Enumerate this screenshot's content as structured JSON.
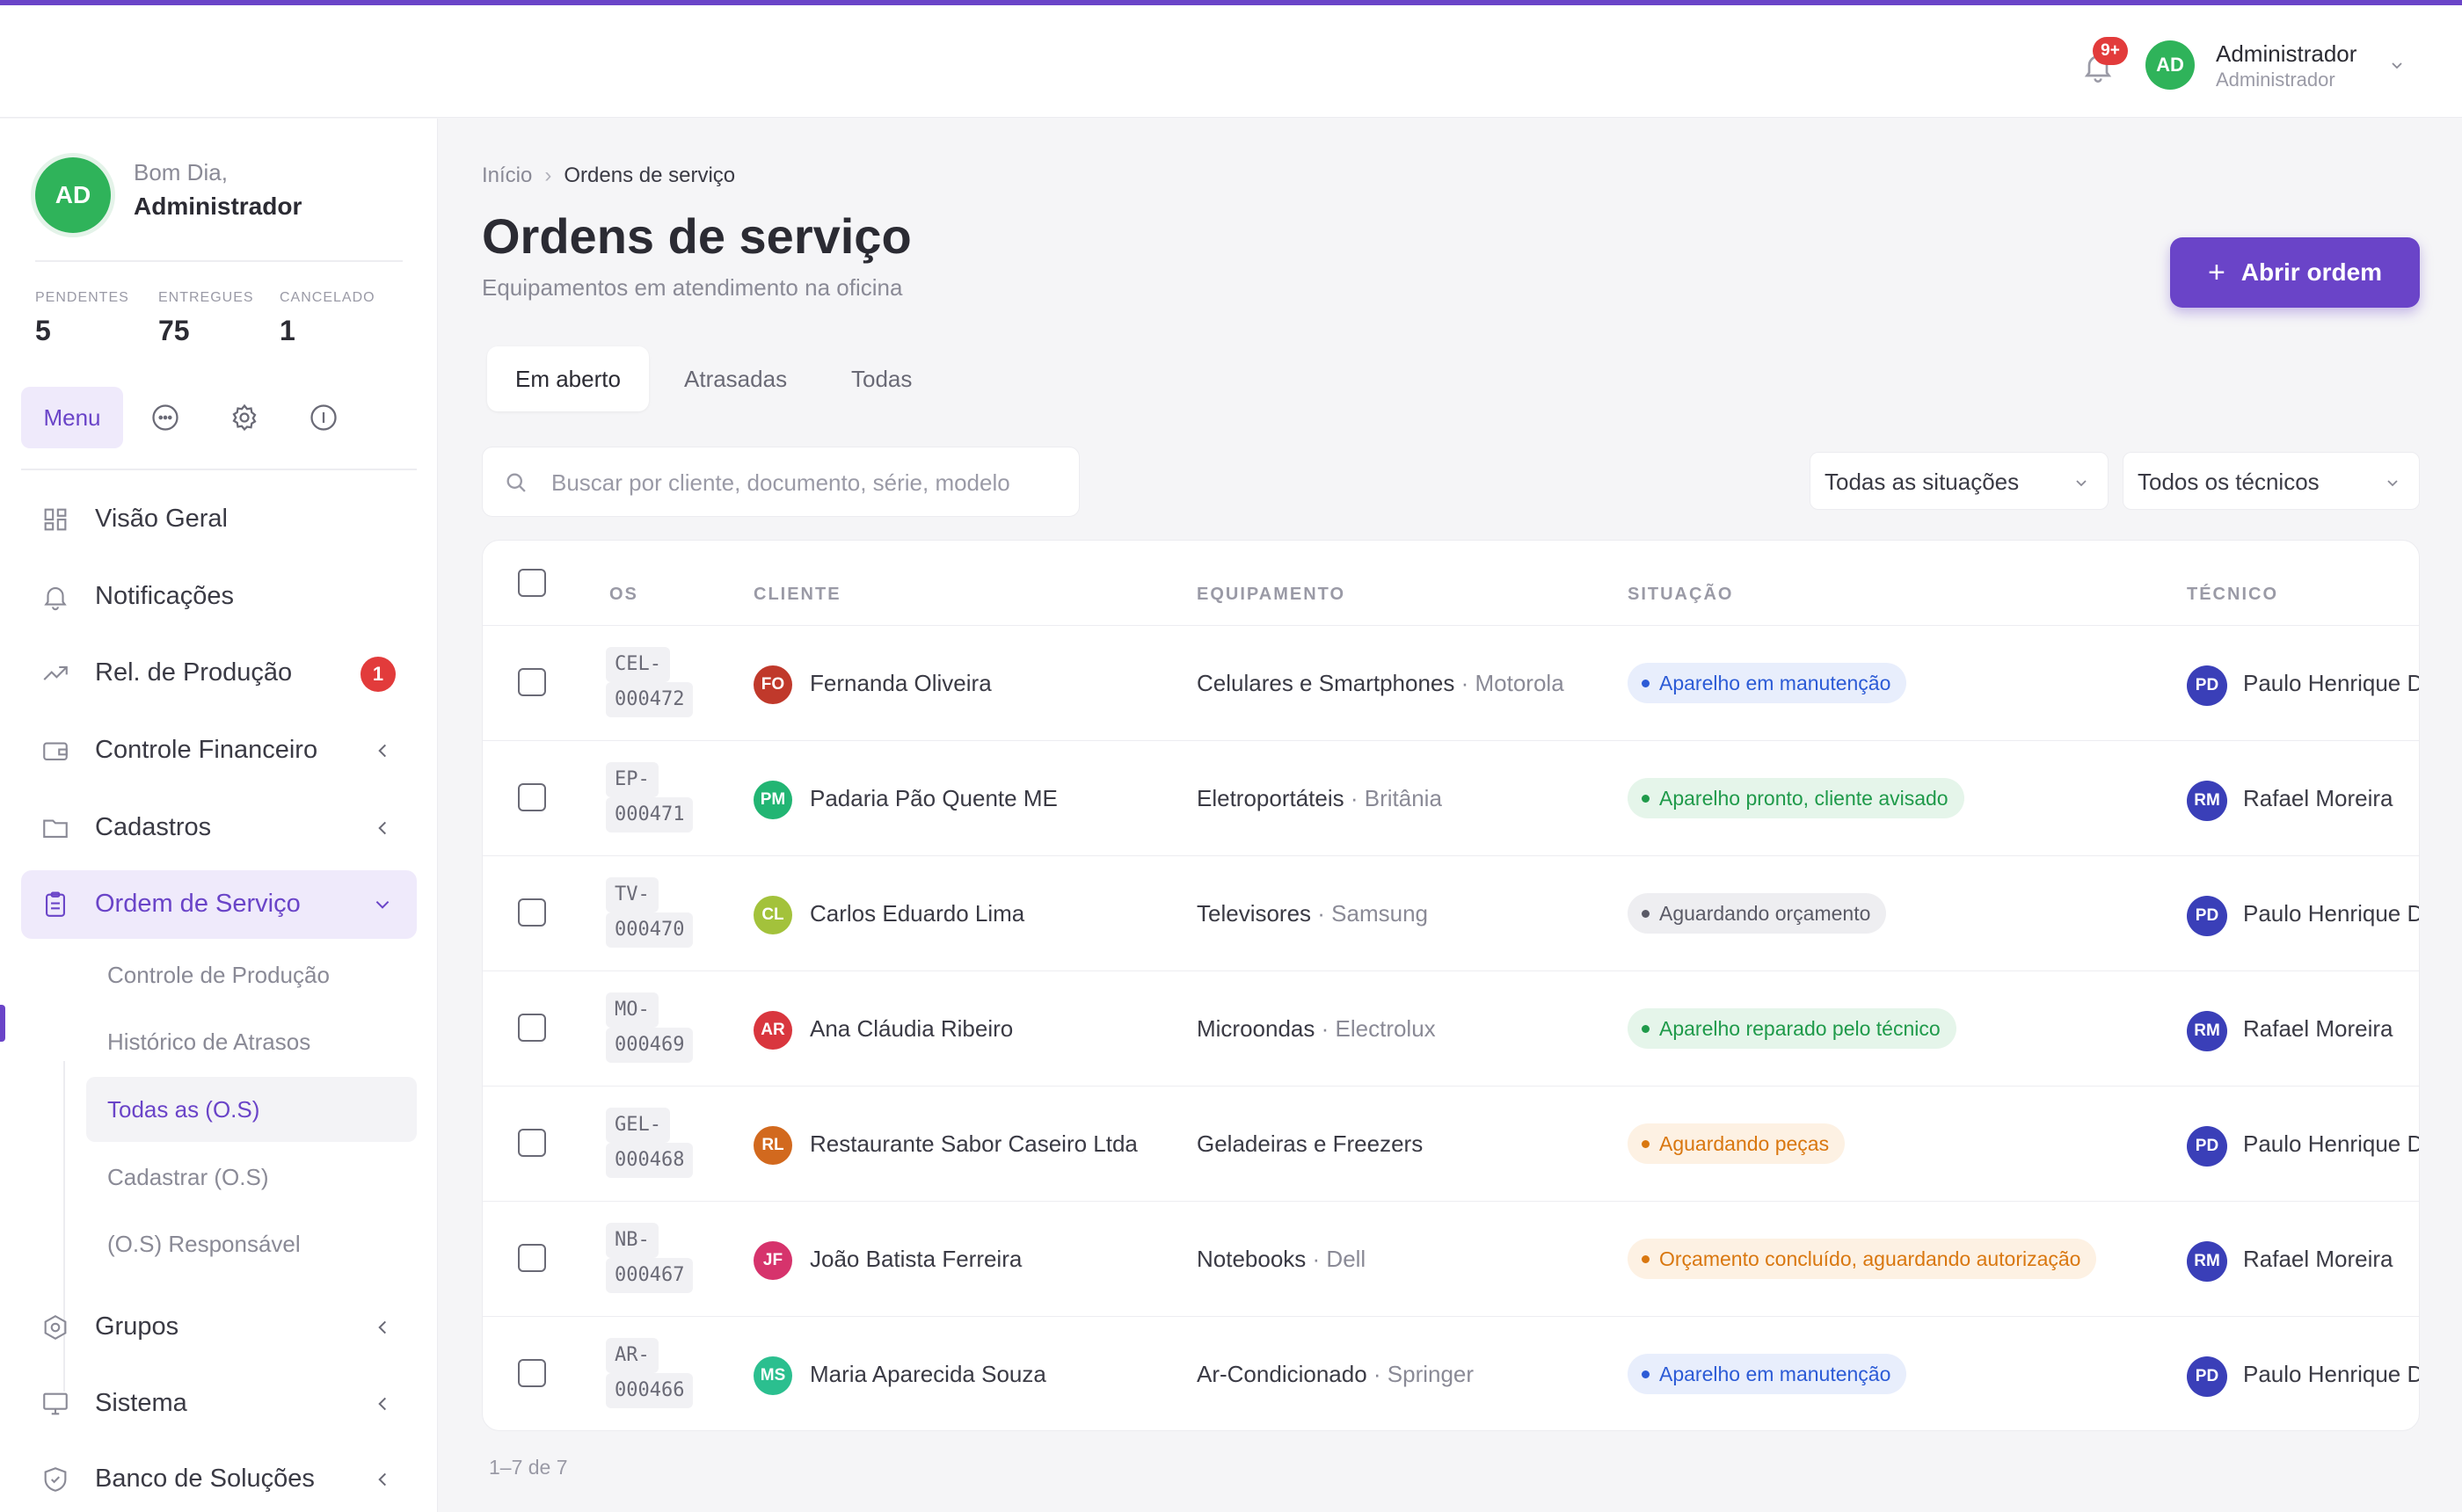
{
  "topbar": {
    "notification_badge": "9+",
    "user_initials": "AD",
    "user_name": "Administrador",
    "user_role": "Administrador"
  },
  "sidebar": {
    "avatar_initials": "AD",
    "greeting": "Bom Dia,",
    "user_name": "Administrador",
    "stats": [
      {
        "label": "PENDENTES",
        "value": "5"
      },
      {
        "label": "ENTREGUES",
        "value": "75"
      },
      {
        "label": "CANCELADO",
        "value": "1"
      }
    ],
    "menu_label": "Menu",
    "nav": [
      {
        "label": "Visão Geral",
        "icon": "grid-icon"
      },
      {
        "label": "Notificações",
        "icon": "bell-icon"
      },
      {
        "label": "Rel. de Produção",
        "icon": "trend-icon",
        "badge": "1"
      },
      {
        "label": "Controle Financeiro",
        "icon": "wallet-icon"
      },
      {
        "label": "Cadastros",
        "icon": "folder-icon"
      },
      {
        "label": "Ordem de Serviço",
        "icon": "clipboard-icon"
      },
      {
        "label": "Grupos",
        "icon": "hexagon-icon"
      },
      {
        "label": "Sistema",
        "icon": "monitor-icon"
      },
      {
        "label": "Banco de Soluções",
        "icon": "shield-icon"
      }
    ],
    "sub_nav": [
      {
        "label": "Controle de Produção"
      },
      {
        "label": "Histórico de Atrasos"
      },
      {
        "label": "Todas as (O.S)"
      },
      {
        "label": "Cadastrar (O.S)"
      },
      {
        "label": "(O.S) Responsável"
      }
    ]
  },
  "main": {
    "breadcrumb": {
      "home": "Início",
      "current": "Ordens de serviço"
    },
    "title": "Ordens de serviço",
    "subtitle": "Equipamentos em atendimento na oficina",
    "open_button": "Abrir ordem",
    "tabs": [
      {
        "label": "Em aberto"
      },
      {
        "label": "Atrasadas"
      },
      {
        "label": "Todas"
      }
    ],
    "search_placeholder": "Buscar por cliente, documento, série, modelo",
    "filter_status": "Todas as situações",
    "filter_tech": "Todos os técnicos",
    "columns": {
      "os": "OS",
      "client": "CLIENTE",
      "equipment": "EQUIPAMENTO",
      "status": "SITUAÇÃO",
      "tech": "TÉCNICO"
    },
    "rows": [
      {
        "os1": "CEL-",
        "os2": "000472",
        "initials": "FO",
        "avatar_color": "#c0392b",
        "client": "Fernanda Oliveira",
        "equipment": "Celulares e Smartphones",
        "brand": " · Motorola",
        "status": "Aparelho em manutenção",
        "status_kind": "blue",
        "tech_initials": "PD",
        "tech": "Paulo Henrique Dias"
      },
      {
        "os1": "EP-",
        "os2": "000471",
        "initials": "PM",
        "avatar_color": "#22b573",
        "client": "Padaria Pão Quente ME",
        "equipment": "Eletroportáteis",
        "brand": " · Britânia",
        "status": "Aparelho pronto, cliente avisado",
        "status_kind": "green",
        "tech_initials": "RM",
        "tech": "Rafael Moreira"
      },
      {
        "os1": "TV-",
        "os2": "000470",
        "initials": "CL",
        "avatar_color": "#a3c23b",
        "client": "Carlos Eduardo Lima",
        "equipment": "Televisores",
        "brand": " · Samsung",
        "status": "Aguardando orçamento",
        "status_kind": "gray",
        "tech_initials": "PD",
        "tech": "Paulo Henrique Dias"
      },
      {
        "os1": "MO-",
        "os2": "000469",
        "initials": "AR",
        "avatar_color": "#d9363e",
        "client": "Ana Cláudia Ribeiro",
        "equipment": "Microondas",
        "brand": " · Electrolux",
        "status": "Aparelho reparado pelo técnico",
        "status_kind": "green",
        "tech_initials": "RM",
        "tech": "Rafael Moreira"
      },
      {
        "os1": "GEL-",
        "os2": "000468",
        "initials": "RL",
        "avatar_color": "#d2691e",
        "client": "Restaurante Sabor Caseiro Ltda",
        "equipment": "Geladeiras e Freezers",
        "brand": "",
        "status": "Aguardando peças",
        "status_kind": "orange",
        "tech_initials": "PD",
        "tech": "Paulo Henrique Dias"
      },
      {
        "os1": "NB-",
        "os2": "000467",
        "initials": "JF",
        "avatar_color": "#d6336c",
        "client": "João Batista Ferreira",
        "equipment": "Notebooks",
        "brand": " · Dell",
        "status": "Orçamento concluído, aguardando autorização",
        "status_kind": "orange",
        "tech_initials": "RM",
        "tech": "Rafael Moreira"
      },
      {
        "os1": "AR-",
        "os2": "000466",
        "initials": "MS",
        "avatar_color": "#2bbf8f",
        "client": "Maria Aparecida Souza",
        "equipment": "Ar-Condicionado",
        "brand": " · Springer",
        "status": "Aparelho em manutenção",
        "status_kind": "blue",
        "tech_initials": "PD",
        "tech": "Paulo Henrique Dias"
      }
    ],
    "pagination": "1–7 de 7"
  }
}
